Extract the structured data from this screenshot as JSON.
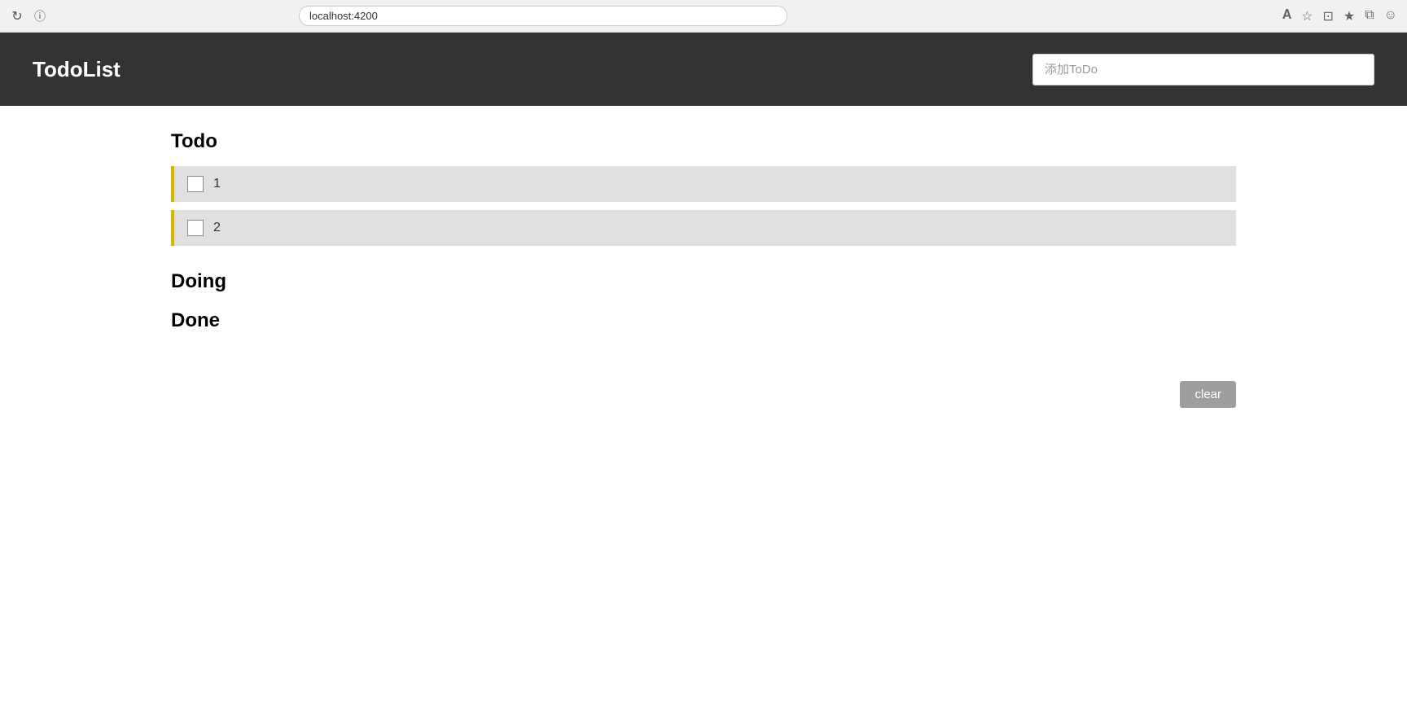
{
  "browser": {
    "url": "localhost:4200",
    "reload_icon": "↻",
    "info_icon": "ⓘ"
  },
  "header": {
    "title": "TodoList",
    "input_placeholder": "添加ToDo"
  },
  "sections": {
    "todo": {
      "label": "Todo",
      "items": [
        {
          "id": 1,
          "text": "1",
          "checked": false
        },
        {
          "id": 2,
          "text": "2",
          "checked": false
        }
      ]
    },
    "doing": {
      "label": "Doing",
      "items": []
    },
    "done": {
      "label": "Done",
      "items": []
    }
  },
  "buttons": {
    "clear_label": "clear"
  },
  "colors": {
    "header_bg": "#333333",
    "todo_border": "#d4b800",
    "todo_bg": "#e0e0e0",
    "clear_bg": "#9e9e9e"
  }
}
